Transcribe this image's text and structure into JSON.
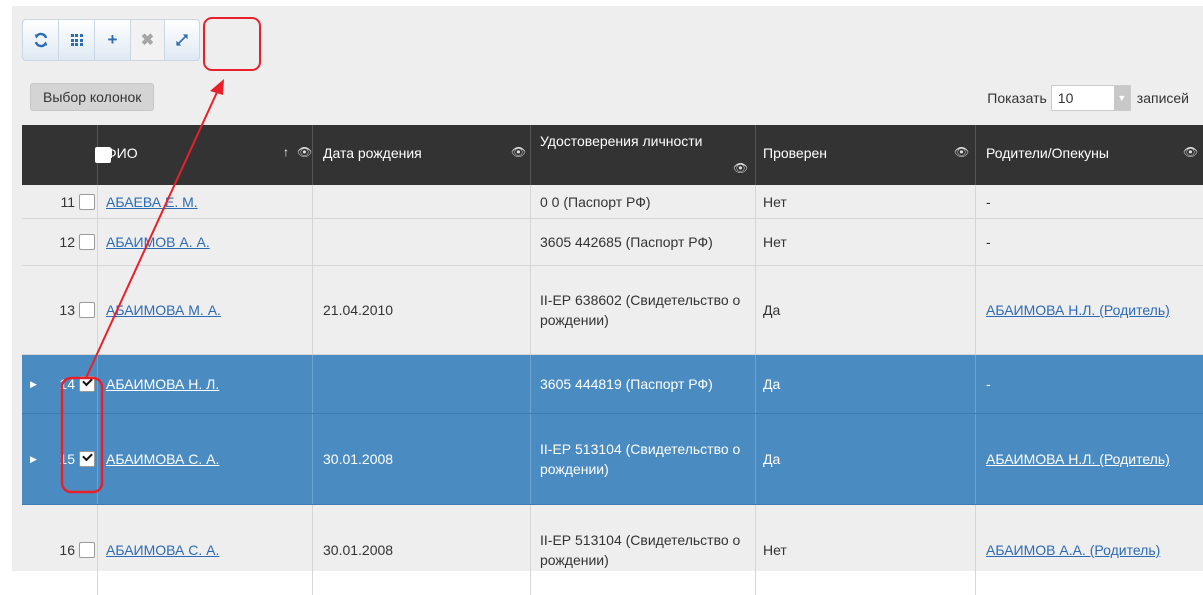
{
  "toolbar": {
    "refresh_icon": "refresh-icon",
    "columns_icon": "grid-icon",
    "add_label": "+",
    "delete_label": "✖",
    "collapse_label": "⤡",
    "annotation_color": "#e8202a"
  },
  "columns_button": "Выбор колонок",
  "page_size": {
    "prefix": "Показать",
    "value": "10",
    "suffix": "записей"
  },
  "table": {
    "headers": {
      "fio": "ФИО",
      "dob": "Дата рождения",
      "doc": "Удостоверения личности",
      "checked": "Проверен",
      "parents": "Родители/Опекуны"
    },
    "rows": [
      {
        "num": "11",
        "checked_box": false,
        "selected": false,
        "fio": "АБАЕВА Е. М.",
        "dob": "",
        "doc": "0 0 (Паспорт РФ)",
        "checked": "Нет",
        "parents": "-"
      },
      {
        "num": "12",
        "checked_box": false,
        "selected": false,
        "fio": "АБАИМОВ А. А.",
        "dob": "",
        "doc": "3605 442685 (Паспорт РФ)",
        "checked": "Нет",
        "parents": "-"
      },
      {
        "num": "13",
        "checked_box": false,
        "selected": false,
        "fio": "АБАИМОВА М. А.",
        "dob": "21.04.2010",
        "doc": "II-ЕР 638602 (Свидетельство о рождении)",
        "checked": "Да",
        "parents": "АБАИМОВА Н.Л. (Родитель)"
      },
      {
        "num": "14",
        "checked_box": true,
        "selected": true,
        "fio": "АБАИМОВА Н. Л.",
        "dob": "",
        "doc": "3605 444819 (Паспорт РФ)",
        "checked": "Да",
        "parents": "-"
      },
      {
        "num": "15",
        "checked_box": true,
        "selected": true,
        "fio": "АБАИМОВА С. А.",
        "dob": "30.01.2008",
        "doc": "II-ЕР 513104 (Свидетельство о рождении)",
        "checked": "Да",
        "parents": "АБАИМОВА Н.Л. (Родитель)"
      },
      {
        "num": "16",
        "checked_box": false,
        "selected": false,
        "fio": "АБАИМОВА С. А.",
        "dob": "30.01.2008",
        "doc": "II-ЕР 513104 (Свидетельство о рождении)",
        "checked": "Нет",
        "parents": "АБАИМОВ А.А. (Родитель)"
      }
    ]
  },
  "colors": {
    "header_bg": "#333333",
    "selected_row_bg": "#4a8bc2",
    "link": "#2d6bb5"
  }
}
